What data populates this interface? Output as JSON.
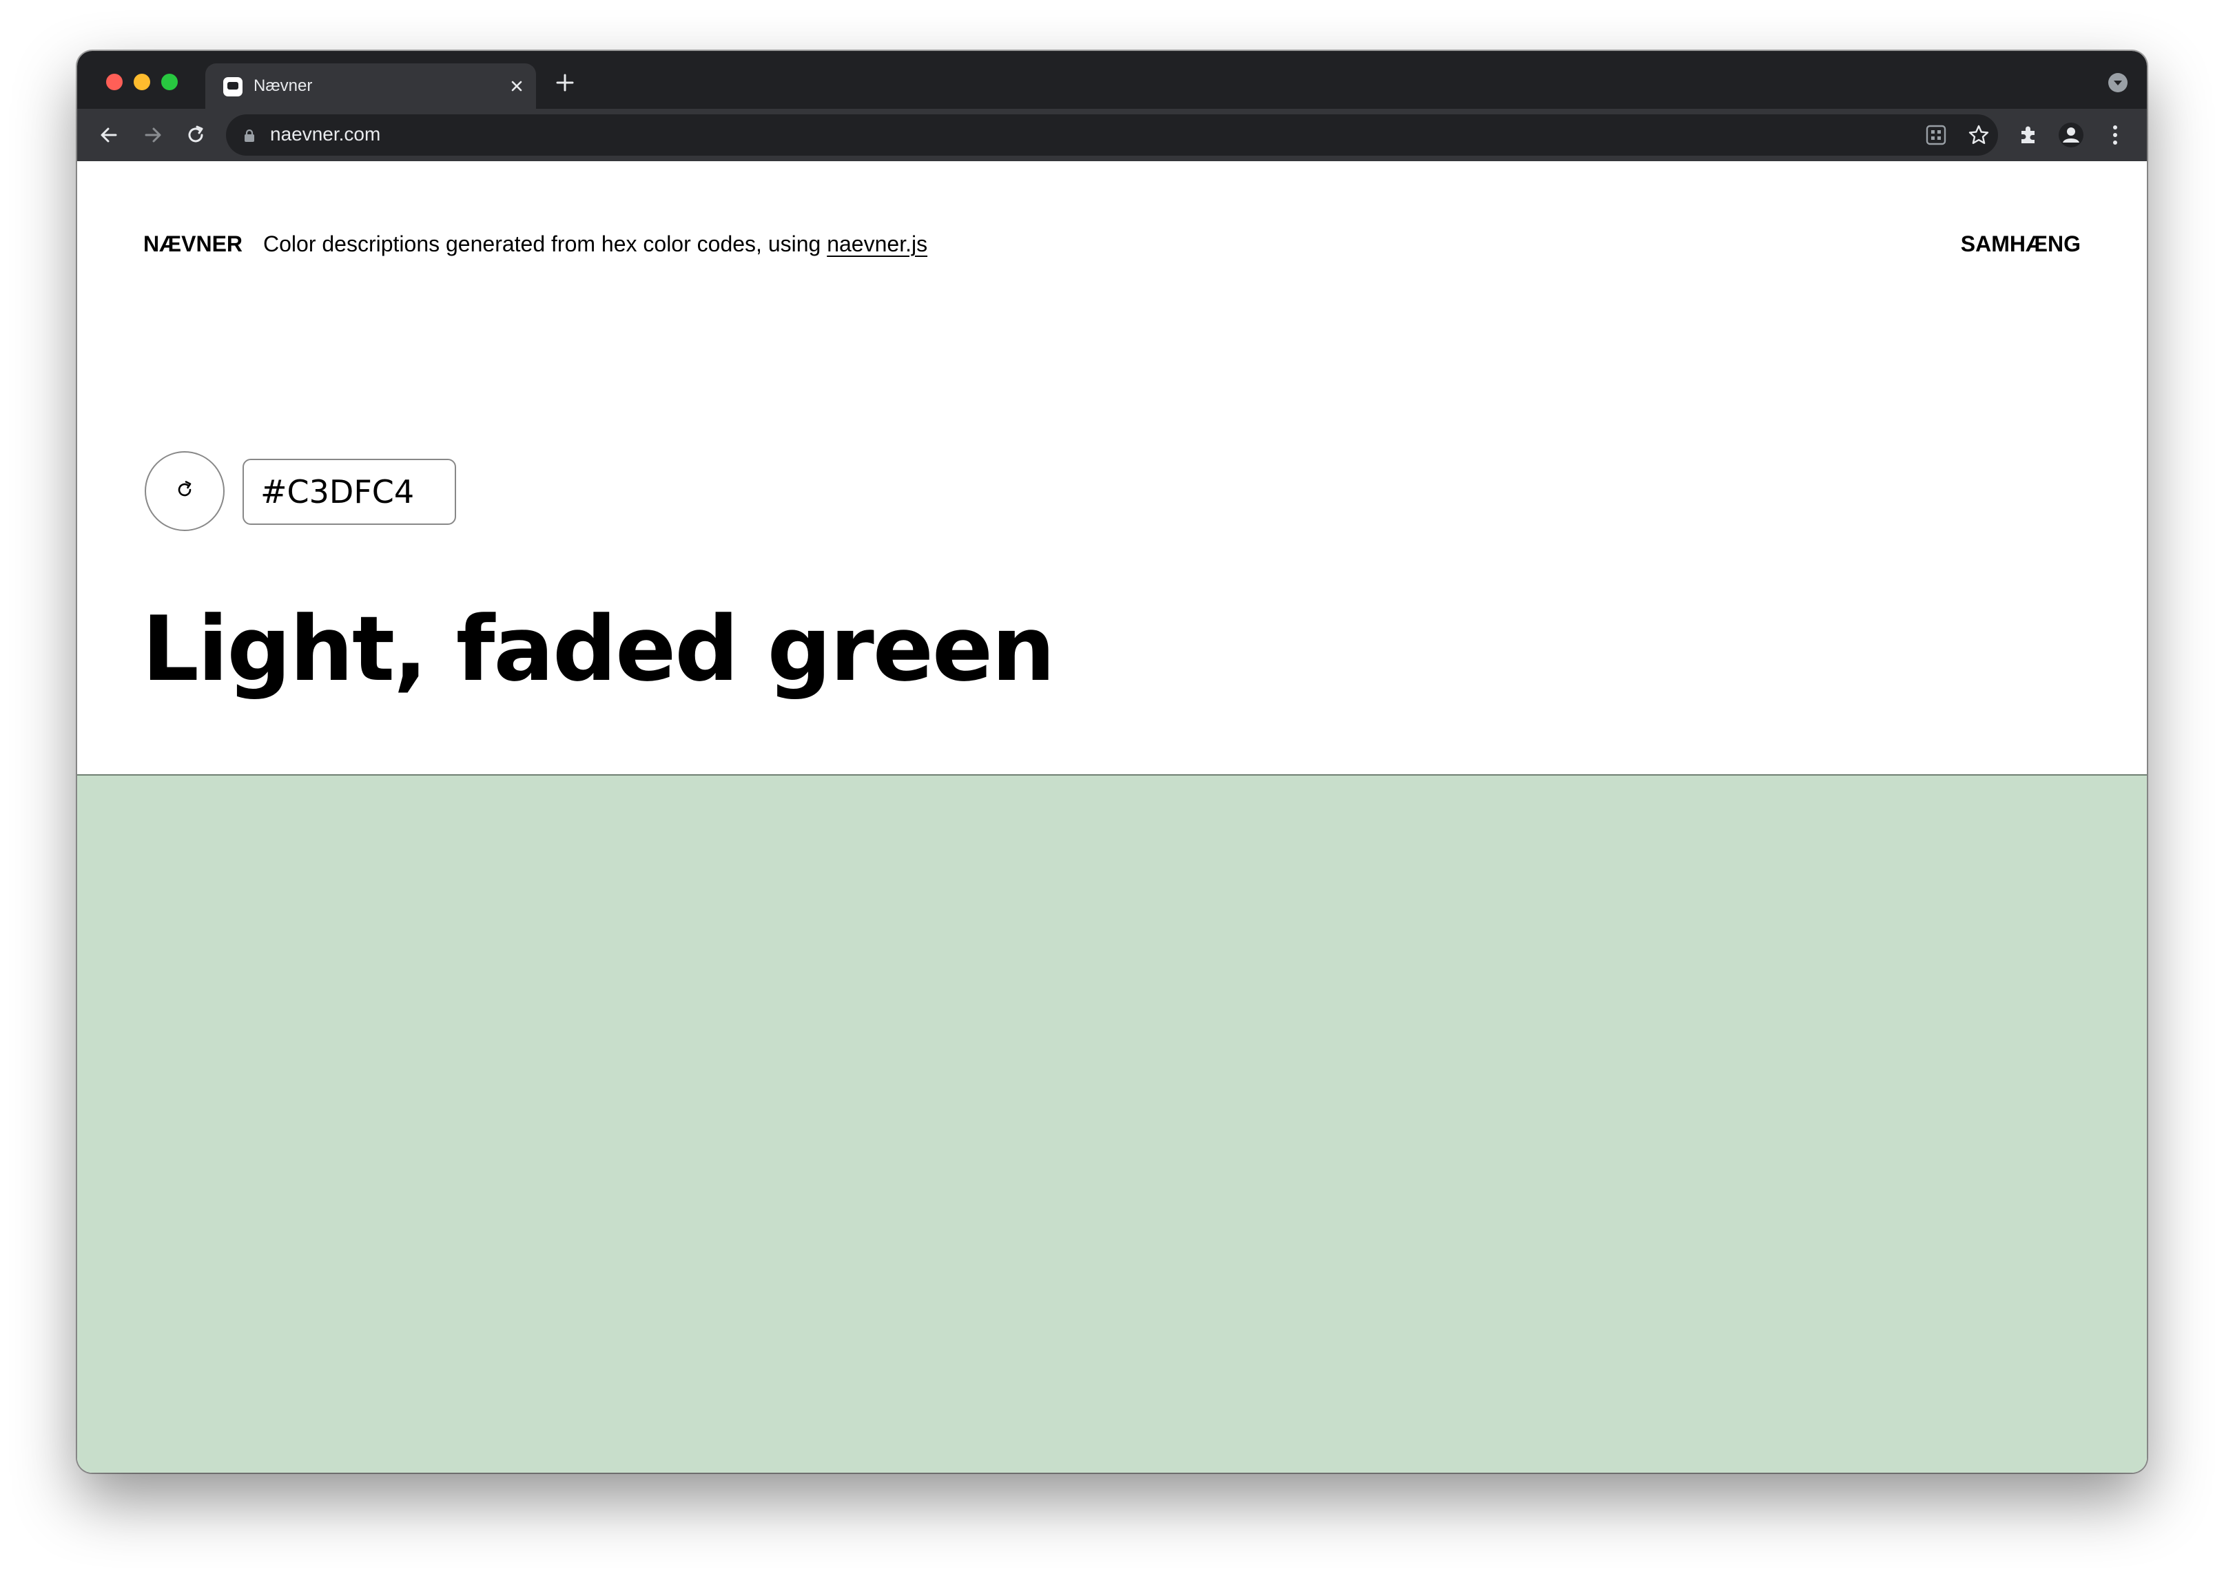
{
  "browser": {
    "tab_title": "Nævner",
    "url": "naevner.com"
  },
  "site": {
    "brand": "NÆVNER",
    "tagline_prefix": "Color descriptions generated from hex color codes, using ",
    "tagline_link": "naevner.js",
    "nav_link": "SAMHÆNG"
  },
  "color": {
    "hex_value": "#C3DFC4",
    "description": "Light, faded green",
    "swatch_color": "#c8decb"
  },
  "icons": {
    "tab_favicon": "chat-bubble-icon",
    "tab_close": "close-icon",
    "new_tab": "plus-icon",
    "back": "arrow-left-icon",
    "forward": "arrow-right-icon",
    "reload": "reload-icon",
    "lock": "lock-icon",
    "qr": "qr-code-icon",
    "bookmark": "star-icon",
    "extensions": "puzzle-icon",
    "profile": "profile-icon",
    "menu": "kebab-menu-icon",
    "refresh_color": "refresh-icon"
  }
}
